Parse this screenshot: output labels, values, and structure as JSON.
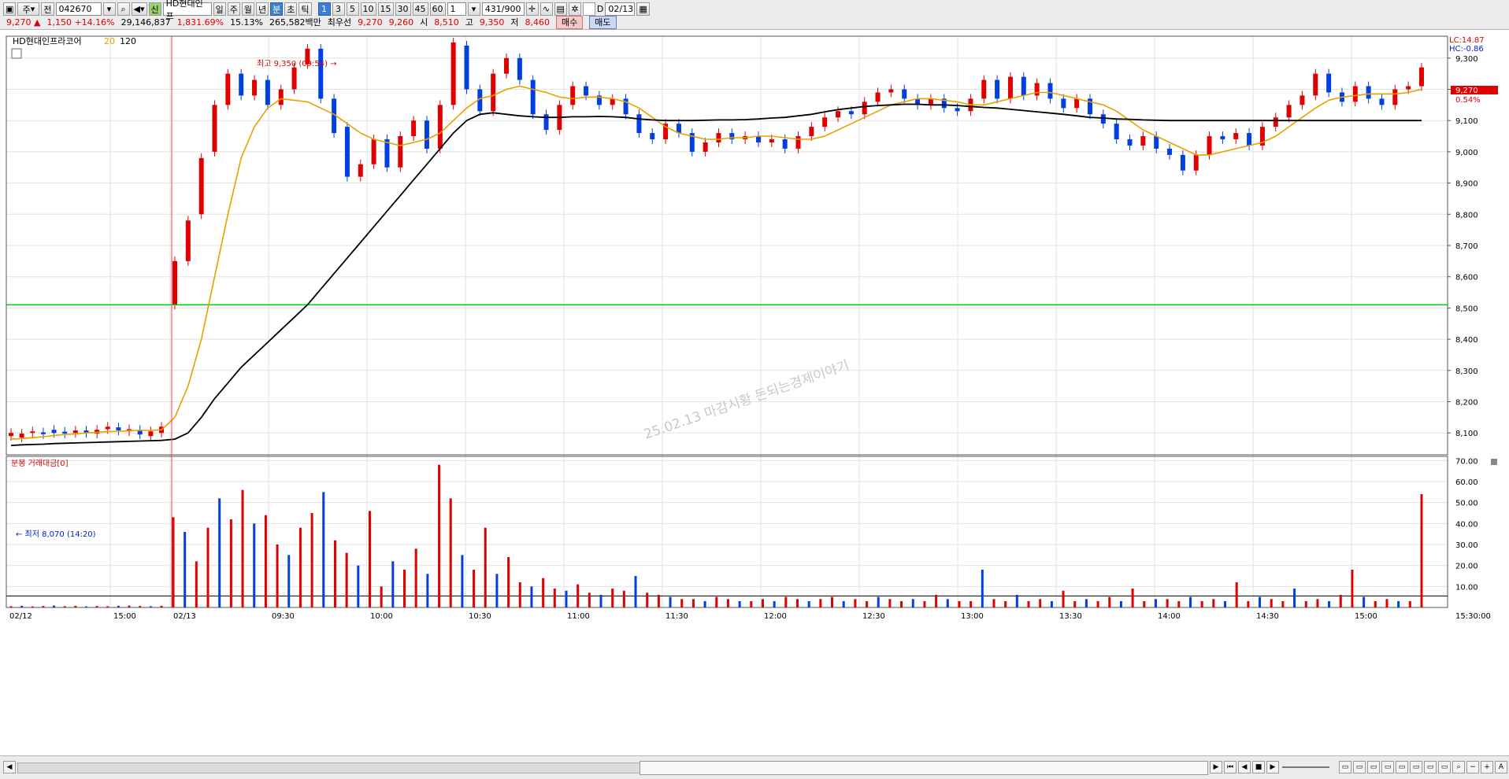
{
  "toolbar": {
    "market_select": "주",
    "prev_label": "전",
    "code": "042670",
    "new_badge": "신",
    "stock_name": "HD현대인프",
    "period_buttons": [
      "일",
      "주",
      "월",
      "년",
      "분",
      "초",
      "틱"
    ],
    "active_period": "분",
    "interval_buttons": [
      "1",
      "3",
      "5",
      "10",
      "15",
      "30",
      "45",
      "60"
    ],
    "active_interval": "1",
    "interval_select": "1",
    "count": "431/900",
    "checkbox_label": "D",
    "date": "02/13"
  },
  "quote": {
    "price": "9,270",
    "arrow": "▲",
    "change": "1,150",
    "change_pct": "+14.16%",
    "volume": "29,146,837",
    "volume_pct": "1,831.69%",
    "turnover": "15.13%",
    "amount": "265,582백만",
    "best_label": "최우선",
    "best_ask": "9,270",
    "best_bid": "9,260",
    "open_label": "시",
    "open": "8,510",
    "high_label": "고",
    "high": "9,350",
    "low_label": "저",
    "low": "8,460",
    "buy_button": "매수",
    "sell_button": "매도"
  },
  "chart_data": {
    "type": "candlestick",
    "legend_name": "HD현대인프라코어",
    "ma_labels": [
      "20",
      "120"
    ],
    "colors": {
      "up": "#e00000",
      "down": "#0040e0",
      "ma20": "#e8a000",
      "ma120": "#000000",
      "ref_line": "#00cc00"
    },
    "price_axis_ticks": [
      "9,300",
      "9,200",
      "9,100",
      "9,000",
      "8,900",
      "8,800",
      "8,700",
      "8,600",
      "8,500",
      "8,400",
      "8,300",
      "8,200",
      "8,100"
    ],
    "ylim": [
      8030,
      9370
    ],
    "reference_line": 8510,
    "lc_label": "LC:14.87",
    "hc_label": "HC:-0.86",
    "current_price_label": "9,270",
    "current_pct_label": "0.54%",
    "high_annotation": "최고 9,350 (09:54) →",
    "low_annotation": "← 최저 8,070 (14:20)",
    "watermark": "25.02.13 마감시황 돈되는경제이야기",
    "x_labels": [
      "02/12",
      "15:00",
      "02/13",
      "09:30",
      "10:00",
      "10:30",
      "11:00",
      "11:30",
      "12:00",
      "12:30",
      "13:00",
      "13:30",
      "14:00",
      "14:30",
      "15:00",
      "15:30:00"
    ],
    "price_path": [
      [
        8090,
        8100
      ],
      [
        8085,
        8098
      ],
      [
        8100,
        8105
      ],
      [
        8102,
        8096
      ],
      [
        8110,
        8100
      ],
      [
        8104,
        8098
      ],
      [
        8100,
        8108
      ],
      [
        8108,
        8100
      ],
      [
        8098,
        8110
      ],
      [
        8112,
        8120
      ],
      [
        8118,
        8108
      ],
      [
        8105,
        8112
      ],
      [
        8110,
        8095
      ],
      [
        8090,
        8105
      ],
      [
        8100,
        8120
      ],
      [
        8510,
        8650
      ],
      [
        8650,
        8780
      ],
      [
        8800,
        8980
      ],
      [
        9000,
        9150
      ],
      [
        9150,
        9250
      ],
      [
        9250,
        9180
      ],
      [
        9180,
        9230
      ],
      [
        9230,
        9150
      ],
      [
        9150,
        9200
      ],
      [
        9200,
        9270
      ],
      [
        9280,
        9330
      ],
      [
        9330,
        9170
      ],
      [
        9170,
        9060
      ],
      [
        9080,
        8920
      ],
      [
        8920,
        8960
      ],
      [
        8960,
        9040
      ],
      [
        9040,
        8950
      ],
      [
        8950,
        9050
      ],
      [
        9050,
        9100
      ],
      [
        9100,
        9010
      ],
      [
        9010,
        9150
      ],
      [
        9150,
        9350
      ],
      [
        9340,
        9200
      ],
      [
        9200,
        9130
      ],
      [
        9130,
        9250
      ],
      [
        9250,
        9300
      ],
      [
        9300,
        9230
      ],
      [
        9230,
        9120
      ],
      [
        9120,
        9070
      ],
      [
        9070,
        9150
      ],
      [
        9150,
        9210
      ],
      [
        9210,
        9180
      ],
      [
        9180,
        9150
      ],
      [
        9150,
        9170
      ],
      [
        9170,
        9120
      ],
      [
        9120,
        9060
      ],
      [
        9060,
        9040
      ],
      [
        9040,
        9090
      ],
      [
        9090,
        9060
      ],
      [
        9060,
        9000
      ],
      [
        9000,
        9030
      ],
      [
        9030,
        9060
      ],
      [
        9060,
        9040
      ],
      [
        9040,
        9050
      ],
      [
        9050,
        9030
      ],
      [
        9030,
        9040
      ],
      [
        9040,
        9010
      ],
      [
        9010,
        9050
      ],
      [
        9050,
        9080
      ],
      [
        9080,
        9110
      ],
      [
        9110,
        9130
      ],
      [
        9130,
        9120
      ],
      [
        9120,
        9160
      ],
      [
        9160,
        9190
      ],
      [
        9190,
        9200
      ],
      [
        9200,
        9170
      ],
      [
        9170,
        9150
      ],
      [
        9150,
        9170
      ],
      [
        9170,
        9140
      ],
      [
        9140,
        9130
      ],
      [
        9130,
        9170
      ],
      [
        9170,
        9230
      ],
      [
        9230,
        9170
      ],
      [
        9170,
        9240
      ],
      [
        9240,
        9180
      ],
      [
        9180,
        9220
      ],
      [
        9220,
        9170
      ],
      [
        9170,
        9140
      ],
      [
        9140,
        9170
      ],
      [
        9170,
        9120
      ],
      [
        9120,
        9090
      ],
      [
        9090,
        9040
      ],
      [
        9040,
        9020
      ],
      [
        9020,
        9050
      ],
      [
        9050,
        9010
      ],
      [
        9010,
        8990
      ],
      [
        8990,
        8940
      ],
      [
        8940,
        8990
      ],
      [
        8990,
        9050
      ],
      [
        9050,
        9040
      ],
      [
        9040,
        9060
      ],
      [
        9060,
        9020
      ],
      [
        9020,
        9080
      ],
      [
        9080,
        9110
      ],
      [
        9110,
        9150
      ],
      [
        9150,
        9180
      ],
      [
        9180,
        9250
      ],
      [
        9250,
        9190
      ],
      [
        9190,
        9160
      ],
      [
        9160,
        9210
      ],
      [
        9210,
        9170
      ],
      [
        9170,
        9150
      ],
      [
        9150,
        9200
      ],
      [
        9200,
        9210
      ],
      [
        9210,
        9270
      ]
    ],
    "ma20_path": [
      8080,
      8082,
      8085,
      8088,
      8092,
      8095,
      8097,
      8100,
      8102,
      8104,
      8105,
      8107,
      8108,
      8108,
      8110,
      8150,
      8250,
      8400,
      8600,
      8800,
      8980,
      9080,
      9140,
      9170,
      9165,
      9160,
      9140,
      9120,
      9090,
      9060,
      9040,
      9030,
      9020,
      9030,
      9040,
      9060,
      9100,
      9140,
      9170,
      9180,
      9200,
      9210,
      9200,
      9190,
      9175,
      9170,
      9175,
      9175,
      9170,
      9160,
      9140,
      9110,
      9080,
      9060,
      9050,
      9040,
      9040,
      9045,
      9045,
      9050,
      9050,
      9045,
      9040,
      9040,
      9050,
      9070,
      9090,
      9110,
      9130,
      9150,
      9160,
      9170,
      9170,
      9165,
      9160,
      9150,
      9150,
      9160,
      9170,
      9180,
      9190,
      9190,
      9180,
      9170,
      9160,
      9150,
      9130,
      9100,
      9070,
      9050,
      9030,
      9010,
      8990,
      8990,
      9000,
      9010,
      9020,
      9030,
      9050,
      9080,
      9110,
      9140,
      9165,
      9175,
      9180,
      9185,
      9185,
      9185,
      9190,
      9200
    ],
    "ma120_path": [
      8060,
      8062,
      8063,
      8064,
      8066,
      8067,
      8068,
      8069,
      8070,
      8071,
      8072,
      8073,
      8074,
      8075,
      8076,
      8080,
      8100,
      8150,
      8210,
      8260,
      8310,
      8350,
      8390,
      8430,
      8470,
      8510,
      8560,
      8610,
      8660,
      8710,
      8760,
      8810,
      8860,
      8910,
      8960,
      9010,
      9060,
      9100,
      9120,
      9125,
      9120,
      9115,
      9112,
      9110,
      9110,
      9112,
      9112,
      9113,
      9112,
      9110,
      9105,
      9102,
      9100,
      9100,
      9100,
      9101,
      9102,
      9102,
      9103,
      9105,
      9108,
      9110,
      9115,
      9120,
      9128,
      9135,
      9140,
      9145,
      9148,
      9150,
      9152,
      9152,
      9150,
      9150,
      9148,
      9145,
      9142,
      9140,
      9136,
      9132,
      9128,
      9124,
      9120,
      9115,
      9110,
      9108,
      9105,
      9104,
      9102,
      9101,
      9100,
      9100,
      9100,
      9100,
      9100,
      9100,
      9100,
      9100,
      9100,
      9100,
      9100,
      9100,
      9100,
      9100,
      9100,
      9100,
      9100,
      9100,
      9100,
      9100
    ],
    "volume_panel": {
      "title": "분봉 거래대금[0]",
      "axis_ticks": [
        "70.00",
        "60.00",
        "50.00",
        "40.00",
        "30.00",
        "20.00",
        "10.00"
      ],
      "ylim": [
        0,
        72
      ],
      "reference_level": 5.5
    },
    "volume_values": [
      0.6,
      0.8,
      0.5,
      0.7,
      0.9,
      0.6,
      0.8,
      0.5,
      0.7,
      0.6,
      0.8,
      0.9,
      0.7,
      0.6,
      0.8,
      43,
      36,
      22,
      38,
      52,
      42,
      56,
      40,
      44,
      30,
      25,
      38,
      45,
      55,
      32,
      26,
      20,
      46,
      10,
      22,
      18,
      28,
      16,
      68,
      52,
      25,
      18,
      38,
      16,
      24,
      12,
      10,
      14,
      9,
      8,
      11,
      7,
      6,
      9,
      8,
      15,
      7,
      6,
      5,
      4,
      4,
      3,
      5,
      4,
      3,
      3,
      4,
      3,
      5,
      4,
      3,
      4,
      5,
      3,
      4,
      3,
      5,
      4,
      3,
      4,
      3,
      6,
      4,
      3,
      3,
      18,
      4,
      3,
      6,
      3,
      4,
      3,
      8,
      3,
      4,
      3,
      5,
      3,
      9,
      3,
      4,
      4,
      3,
      5,
      3,
      4,
      3,
      12,
      3,
      5,
      4,
      3,
      9,
      3,
      4,
      3,
      6,
      18,
      5,
      3,
      4,
      3,
      3,
      54
    ]
  },
  "statusbar": {
    "buttons": [
      "◀",
      "▶",
      "⏮",
      "◀",
      "■",
      "▶",
      "−",
      "+",
      "A"
    ]
  }
}
